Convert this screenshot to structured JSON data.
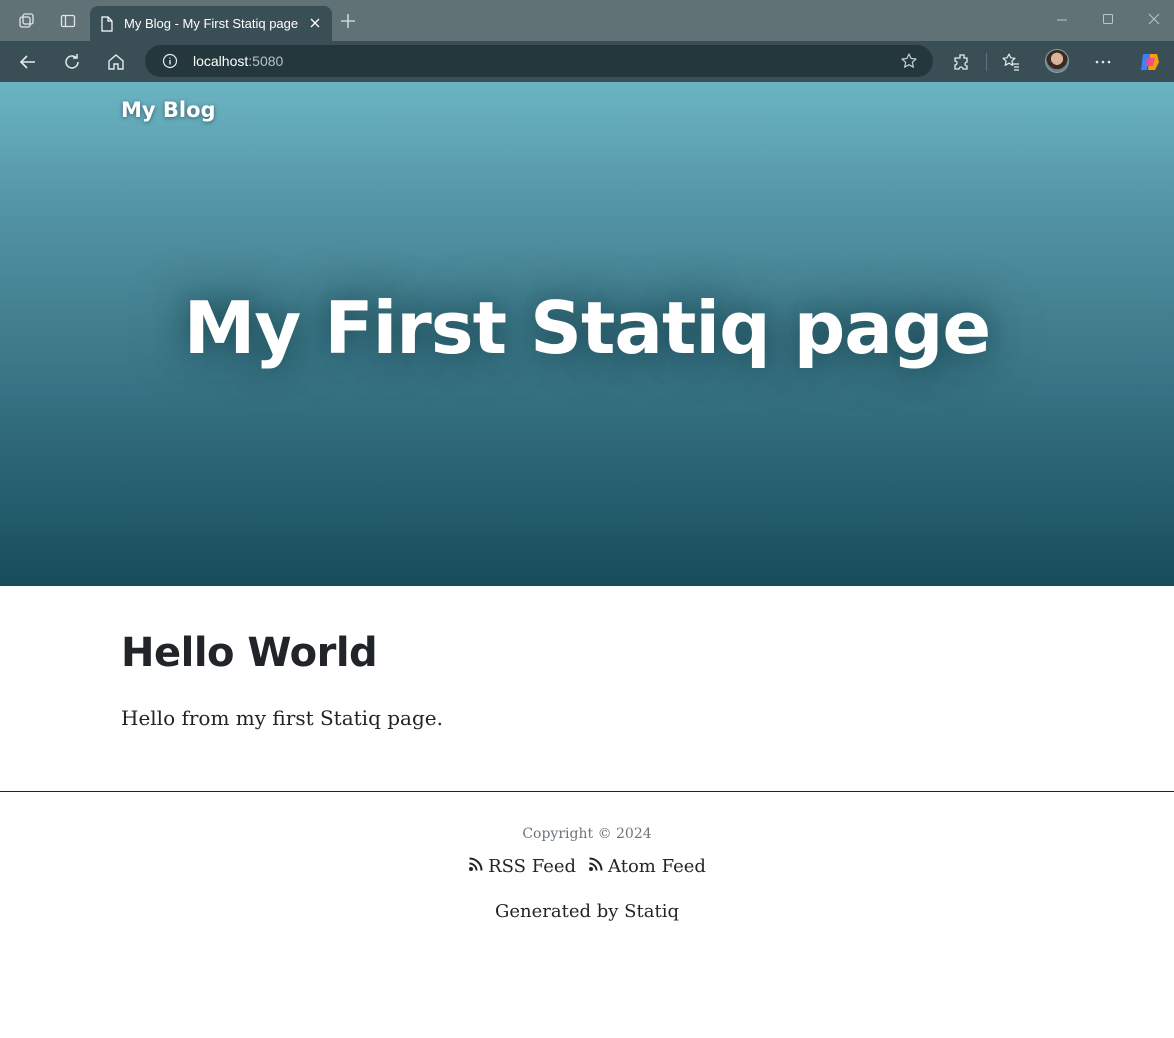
{
  "browser": {
    "tab_title": "My Blog - My First Statiq page",
    "url_host": "localhost",
    "url_port": ":5080"
  },
  "page": {
    "brand": "My Blog",
    "hero_title": "My First Statiq page",
    "heading": "Hello World",
    "body_text": "Hello from my first Statiq page."
  },
  "footer": {
    "copyright": "Copyright © 2024",
    "rss_label": "RSS Feed",
    "atom_label": "Atom Feed",
    "generated_prefix": "Generated by ",
    "generated_link": "Statiq"
  },
  "icons": {
    "workspaces": "workspaces-icon",
    "tab_actions": "tab-actions-icon",
    "back": "back-arrow-icon",
    "refresh": "refresh-icon",
    "home": "home-icon",
    "info": "info-icon",
    "favorite": "star-icon",
    "extensions": "extensions-icon",
    "favorites": "favorites-icon",
    "more": "more-icon",
    "copilot": "copilot-icon",
    "feed": "rss-icon"
  },
  "colors": {
    "hero_top": "#6bb4c3",
    "hero_bottom": "#174d5c",
    "text": "#212529",
    "muted": "#6c757d"
  }
}
